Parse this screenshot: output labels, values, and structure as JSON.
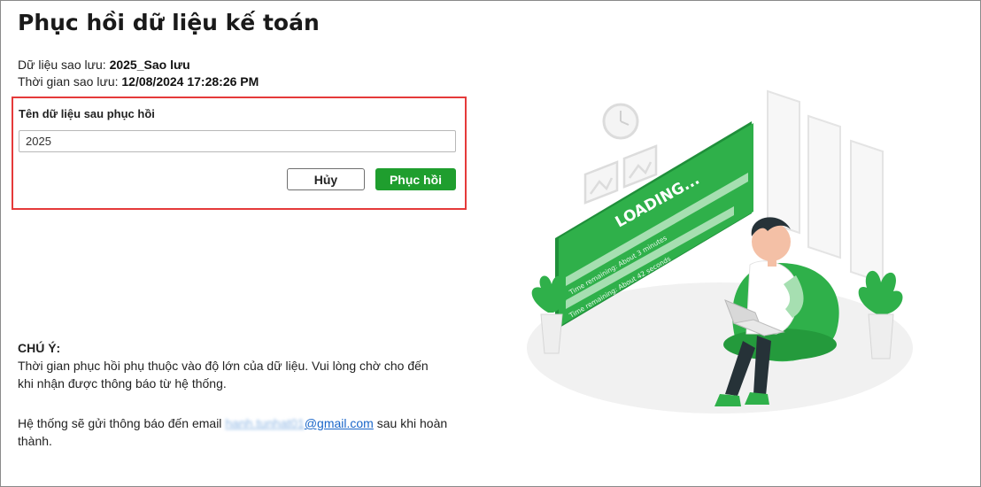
{
  "page": {
    "title": "Phục hồi dữ liệu kế toán"
  },
  "backup": {
    "data_label": "Dữ liệu sao lưu: ",
    "data_value": "2025_Sao lưu",
    "time_label": "Thời gian sao lưu: ",
    "time_value": "12/08/2024 17:28:26 PM"
  },
  "form": {
    "name_label": "Tên dữ liệu sau phục hồi",
    "name_value": "2025",
    "cancel_label": "Hủy",
    "restore_label": "Phục hồi"
  },
  "note": {
    "title": "CHÚ Ý:",
    "body": "Thời gian phục hồi phụ thuộc vào độ lớn của dữ liệu. Vui lòng chờ cho đến khi nhận được thông báo từ hệ thống.",
    "email_prefix": "Hệ thống sẽ gửi thông báo đến email ",
    "email_masked": "hanh.tunhat01",
    "email_domain": "@gmail.com",
    "email_suffix": " sau khi hoàn thành."
  },
  "illustration": {
    "loading_text": "LOADING...",
    "progress_1_text": "Time remaining: About 3 minutes",
    "progress_2_text": "Time remaining: About 42 seconds",
    "accent_color": "#2fb04a"
  }
}
